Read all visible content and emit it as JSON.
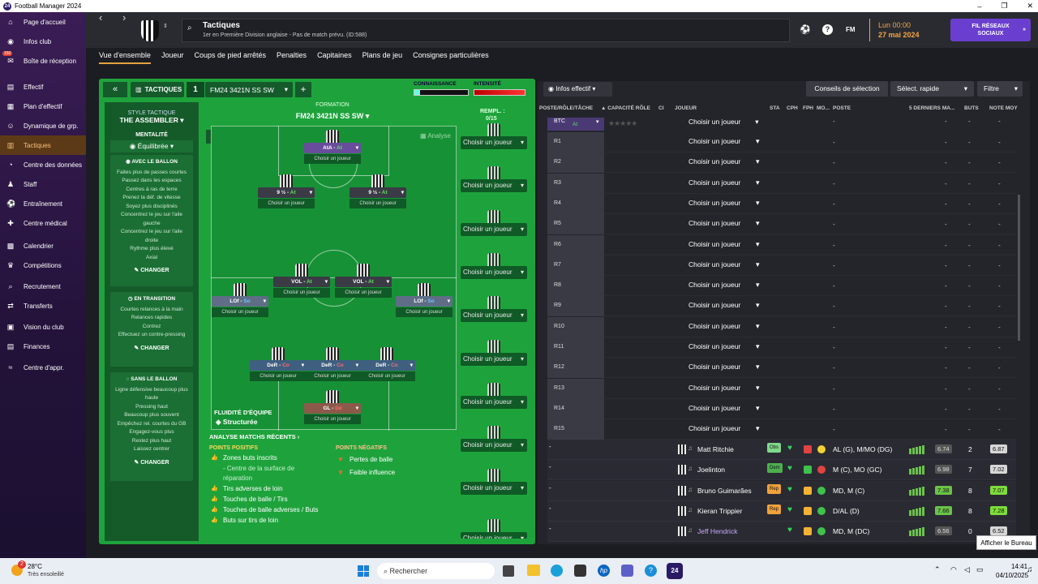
{
  "window": {
    "title": "Football Manager 2024",
    "logo_text": "24",
    "controls": [
      "–",
      "❐",
      "✕"
    ]
  },
  "sidebar": {
    "items": [
      {
        "label": "Page d'accueil",
        "icon": "home-icon",
        "glyph": "⌂"
      },
      {
        "label": "Infos club",
        "icon": "club-icon",
        "glyph": "◉"
      },
      {
        "label": "Boîte de réception",
        "icon": "inbox-icon",
        "glyph": "✉",
        "badge": "150"
      },
      {
        "label": "Effectif",
        "icon": "squad-icon",
        "glyph": "▤"
      },
      {
        "label": "Plan d'effectif",
        "icon": "plan-icon",
        "glyph": "▦"
      },
      {
        "label": "Dynamique de grp.",
        "icon": "dynamics-icon",
        "glyph": "☺"
      },
      {
        "label": "Tactiques",
        "icon": "tactics-icon",
        "glyph": "▥"
      },
      {
        "label": "Centre des données",
        "icon": "data-icon",
        "glyph": "◔"
      },
      {
        "label": "Staff",
        "icon": "staff-icon",
        "glyph": "♟"
      },
      {
        "label": "Entraînement",
        "icon": "training-icon",
        "glyph": "⚽"
      },
      {
        "label": "Centre médical",
        "icon": "medical-icon",
        "glyph": "✚"
      },
      {
        "label": "Calendrier",
        "icon": "calendar-icon",
        "glyph": "▩"
      },
      {
        "label": "Compétitions",
        "icon": "trophy-icon",
        "glyph": "♛"
      },
      {
        "label": "Recrutement",
        "icon": "scouting-icon",
        "glyph": "⌕"
      },
      {
        "label": "Transferts",
        "icon": "transfers-icon",
        "glyph": "⇄"
      },
      {
        "label": "Vision du club",
        "icon": "vision-icon",
        "glyph": "▣"
      },
      {
        "label": "Finances",
        "icon": "finances-icon",
        "glyph": "▤"
      },
      {
        "label": "Centre d'appr.",
        "icon": "learning-icon",
        "glyph": "≈"
      }
    ],
    "active": "Tactiques"
  },
  "header": {
    "title": "Tactiques",
    "subtitle": "1er en Première Division anglaise - Pas de match prévu. (ID:588)",
    "time": "Lun 00:00",
    "date": "27 mai 2024",
    "social": "FIL RÉSEAUX SOCIAUX",
    "fm": "FM"
  },
  "tabs": [
    "Vue d'ensemble",
    "Joueur",
    "Coups de pied arrêtés",
    "Penalties",
    "Capitaines",
    "Plans de jeu",
    "Consignes particulières"
  ],
  "tactic": {
    "label": "TACTIQUES",
    "slot": "1",
    "name": "FM24 3421N SS SW",
    "add": "+",
    "knowledge": "CONNAISSANCE",
    "intensity": "INTENSITÉ",
    "style_label": "STYLE TACTIQUE",
    "style": "THE ASSEMBLER",
    "mentality_label": "MENTALITÉ",
    "mentality": "Équilibrée",
    "in_possession": {
      "title": "AVEC LE BALLON",
      "items": [
        "Faites plus de passes courtes",
        "Passez dans les espaces",
        "Centres à ras de terre",
        "Prenez la déf. de vitesse",
        "Soyez plus disciplinés",
        "Concentrez le jeu sur l'aile gauche",
        "Concentrez le jeu sur l'aile droite",
        "Rythme plus élevé",
        "Axial"
      ]
    },
    "transition": {
      "title": "EN TRANSITION",
      "items": [
        "Courtes relances à la main",
        "Relances rapides",
        "Contrez",
        "Effectuez un contre-pressing"
      ]
    },
    "out_possession": {
      "title": "SANS LE BALLON",
      "items": [
        "Ligne défensive beaucoup plus haute",
        "Pressing haut",
        "Beaucoup plus souvent",
        "Empêchez rel. courtes du GB",
        "Engagez-vous plus",
        "Restez plus haut",
        "Laissez centrer"
      ]
    },
    "change": "CHANGER",
    "formation_label": "FORMATION",
    "formation": "FM24 3421N SS SW",
    "analysis": "Analyse",
    "fluidity_label": "FLUIDITÉ D'ÉQUIPE",
    "fluidity": "Structurée",
    "subs_label": "REMPL. :",
    "subs_count": "0/15",
    "choose": "Choisir un joueur",
    "recent": "ANALYSE MATCHS RÉCENTS",
    "positives_label": "POINTS POSITIFS",
    "positives": [
      "Zones buts inscrits",
      "- Centre de la surface de réparation",
      "Tirs adverses de loin",
      "Touches de balle / Tirs",
      "Touches de balle adverses / Buts",
      "Buts sur tirs de loin"
    ],
    "negatives_label": "POINTS NÉGATIFS",
    "negatives": [
      "Pertes de balle",
      "Faible influence"
    ]
  },
  "positions": [
    {
      "name": "AtA",
      "duty": "At",
      "cls": "a"
    },
    {
      "name": "9 ½",
      "duty": "At",
      "cls": "a"
    },
    {
      "name": "9 ½",
      "duty": "At",
      "cls": "a"
    },
    {
      "name": "VOL",
      "duty": "At",
      "cls": "a"
    },
    {
      "name": "VOL",
      "duty": "At",
      "cls": "a"
    },
    {
      "name": "LOf",
      "duty": "So",
      "cls": "s"
    },
    {
      "name": "LOf",
      "duty": "So",
      "cls": "s"
    },
    {
      "name": "DeR",
      "duty": "Co",
      "cls": "d"
    },
    {
      "name": "DeR",
      "duty": "Co",
      "cls": "d"
    },
    {
      "name": "DeR",
      "duty": "Co",
      "cls": "d"
    },
    {
      "name": "GL",
      "duty": "De",
      "cls": "d"
    }
  ],
  "right": {
    "info_btn": "Infos effectif",
    "advice": "Conseils de sélection",
    "quick": "Sélect. rapide",
    "filter": "Filtre",
    "cols": [
      "POSTE/RÔLE/TÂCHE",
      "▲ CAPACITÉ RÔLE",
      "CI",
      "JOUEUR",
      "STA",
      "CPH",
      "FPH",
      "MO...",
      "POSTE",
      "5 DERNIERS MA...",
      "BUTS",
      "NOTE MOY"
    ],
    "first_slot": "BTC",
    "first_duty": "At",
    "slots": [
      "R1",
      "R2",
      "R3",
      "R4",
      "R5",
      "R6",
      "R7",
      "R8",
      "R9",
      "R10",
      "R11",
      "R12",
      "R13",
      "R14",
      "R15"
    ],
    "dash": "-",
    "players": [
      {
        "name": "Matt Ritchie",
        "tag": "Obs",
        "pos": "AL (G), M/MO (DG)",
        "avg": "6.74",
        "goals": "2",
        "rating": "6.87"
      },
      {
        "name": "Joelinton",
        "tag": "Dem",
        "pos": "M (C), MO (GC)",
        "avg": "6.98",
        "goals": "7",
        "rating": "7.02"
      },
      {
        "name": "Bruno Guimarães",
        "tag": "Rep",
        "pos": "MD, M (C)",
        "avg": "7.38",
        "goals": "8",
        "rating": "7.07"
      },
      {
        "name": "Kieran Trippier",
        "tag": "Rep",
        "pos": "D/AL (D)",
        "avg": "7.66",
        "goals": "8",
        "rating": "7.28"
      },
      {
        "name": "Jeff Hendrick",
        "tag": "",
        "pos": "MD, M (DC)",
        "avg": "6.56",
        "goals": "0",
        "rating": "6.52"
      }
    ],
    "tooltip": "Afficher le Bureau"
  },
  "taskbar": {
    "weather": "28°C",
    "weather_sub": "Très ensoleillé",
    "search": "Rechercher",
    "time": "14:41",
    "date": "04/10/2025",
    "badge": "2"
  },
  "colors": {
    "accent": "#e3a13c",
    "pitch": "#1ea33c",
    "purple": "#6a3fcf"
  }
}
